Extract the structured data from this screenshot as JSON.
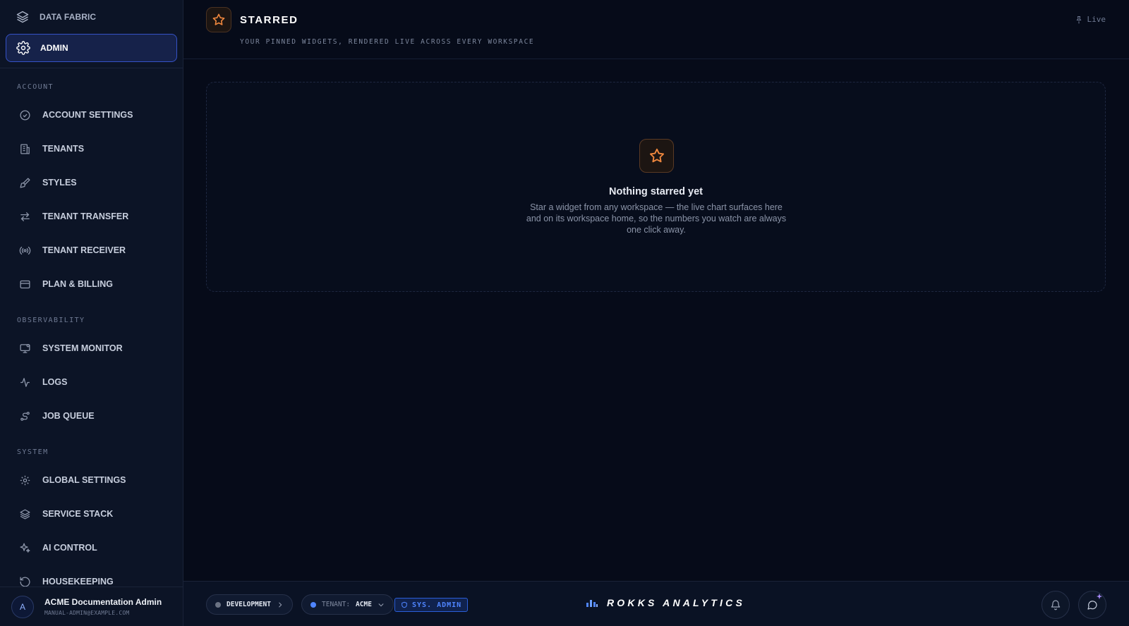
{
  "sidebar": {
    "top_items": [
      {
        "label": "DATA FABRIC",
        "icon": "layers-icon"
      },
      {
        "label": "ADMIN",
        "icon": "gear-icon",
        "active": true
      }
    ],
    "sections": [
      {
        "label": "ACCOUNT",
        "items": [
          {
            "label": "ACCOUNT SETTINGS",
            "icon": "check-circle-icon"
          },
          {
            "label": "TENANTS",
            "icon": "building-icon"
          },
          {
            "label": "STYLES",
            "icon": "paintbrush-icon"
          },
          {
            "label": "TENANT TRANSFER",
            "icon": "arrows-transfer-icon"
          },
          {
            "label": "TENANT RECEIVER",
            "icon": "radio-broadcast-icon"
          },
          {
            "label": "PLAN & BILLING",
            "icon": "credit-card-icon"
          }
        ]
      },
      {
        "label": "OBSERVABILITY",
        "items": [
          {
            "label": "SYSTEM MONITOR",
            "icon": "monitor-icon"
          },
          {
            "label": "LOGS",
            "icon": "activity-icon"
          },
          {
            "label": "JOB QUEUE",
            "icon": "workflow-icon"
          }
        ]
      },
      {
        "label": "SYSTEM",
        "items": [
          {
            "label": "GLOBAL SETTINGS",
            "icon": "gear-icon"
          },
          {
            "label": "SERVICE STACK",
            "icon": "layers-icon"
          },
          {
            "label": "AI CONTROL",
            "icon": "sparkles-icon"
          },
          {
            "label": "HOUSEKEEPING",
            "icon": "refresh-icon"
          }
        ]
      }
    ],
    "user": {
      "initial": "A",
      "name": "ACME Documentation Admin",
      "email": "MANUAL-ADMIN@EXAMPLE.COM"
    }
  },
  "header": {
    "title": "STARRED",
    "subtitle": "YOUR PINNED WIDGETS, RENDERED LIVE ACROSS EVERY WORKSPACE",
    "live_label": "Live"
  },
  "empty_state": {
    "title": "Nothing starred yet",
    "description": "Star a widget from any workspace — the live chart surfaces here and on its workspace home, so the numbers you watch are always one click away."
  },
  "footer": {
    "environment": "DEVELOPMENT",
    "tenant_prefix": "TENANT:",
    "tenant_value": "ACME",
    "role_badge": "SYS. ADMIN",
    "brand": "ROKKS ANALYTICS"
  },
  "colors": {
    "accent_orange": "#f0883e",
    "accent_blue": "#4f85ff",
    "background": "#060b19"
  }
}
